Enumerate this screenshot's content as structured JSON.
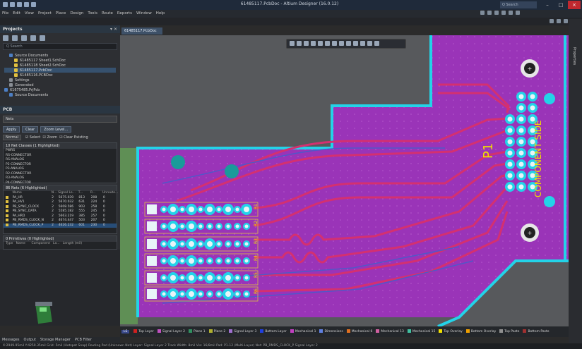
{
  "window": {
    "title": "61485117.PcbDoc - Altium Designer (16.0.12)",
    "search_placeholder": "Q Search",
    "min_icon": "minimize-icon",
    "max_icon": "maximize-icon",
    "close_symbol": "×"
  },
  "menu": [
    "File",
    "Edit",
    "View",
    "Project",
    "Place",
    "Design",
    "Tools",
    "Route",
    "Reports",
    "Window",
    "Help"
  ],
  "projects_panel": {
    "title": "Projects",
    "controls": "▾ ✕",
    "search_placeholder": "Q Search",
    "tree": [
      {
        "label": "Source Documents",
        "indent": 1,
        "color": "#4d7fc4"
      },
      {
        "label": "61485117 Sheet1.SchDoc",
        "indent": 2,
        "color": "#e0c040"
      },
      {
        "label": "61485118 Sheet2.SchDoc",
        "indent": 2,
        "color": "#e0c040"
      },
      {
        "label": "61485117.PcbDoc",
        "indent": 2,
        "color": "#e0c040",
        "selected": true
      },
      {
        "label": "61485116.PCBDoc",
        "indent": 2,
        "color": "#e0c040"
      },
      {
        "label": "Settings",
        "indent": 1,
        "color": "#8a8f96"
      },
      {
        "label": "Generated",
        "indent": 1,
        "color": "#8a8f96"
      },
      {
        "label": "61675485.PrjPcb",
        "indent": 0,
        "color": "#4d7fc4"
      },
      {
        "label": "Source Documents",
        "indent": 1,
        "color": "#4d7fc4"
      }
    ]
  },
  "pcb_panel": {
    "title": "PCB",
    "mode": "Nets",
    "buttons": [
      "Apply",
      "Clear",
      "Zoom Level..."
    ],
    "mask_label": "Normal",
    "options": [
      "Select",
      "Zoom",
      "Clear Existing"
    ],
    "net_classes_header": "10 Net Classes (1 Highlighted)",
    "net_classes": [
      "PWRS",
      "RS-CONNECTOR",
      "RS-ANALOG",
      "P2-CONNECTOR",
      "P3-ANALOG",
      "R2-CONNECTOR",
      "R3-ANALOG",
      "P4-CONNECTOR"
    ],
    "nets_header": "86 Nets (6 Highlighted)",
    "nets_columns": [
      "",
      "Name",
      "N...",
      "Signal Le...",
      "T...",
      "R...",
      "Unroute..."
    ],
    "nets": [
      {
        "name": "PA_HR",
        "n": "2",
        "len": "5675.039",
        "t": "813",
        "r": "208",
        "u": "0",
        "color": "#e0c040"
      },
      {
        "name": "PA_HV1",
        "n": "2",
        "len": "5670.032",
        "t": "631",
        "r": "224",
        "u": "0",
        "color": "#e0c040"
      },
      {
        "name": "PB_SYNC_CLOCK",
        "n": "2",
        "len": "5608.586",
        "t": "903",
        "r": "258",
        "u": "0",
        "color": "#e0c040"
      },
      {
        "name": "PB_SYNC_DATA",
        "n": "2",
        "len": "5585.182",
        "t": "555",
        "r": "245",
        "u": "0",
        "color": "#e0c040"
      },
      {
        "name": "PA_HRD",
        "n": "2",
        "len": "5663.219",
        "t": "385",
        "r": "257",
        "u": "0",
        "color": "#e0c040"
      },
      {
        "name": "PB_RMDS_CLOCK_N",
        "n": "2",
        "len": "4674.447",
        "t": "503",
        "r": "207",
        "u": "0",
        "color": "#e0c040"
      },
      {
        "name": "PB_RMDS_CLOCK_P",
        "n": "2",
        "len": "4626.232",
        "t": "601",
        "r": "230",
        "u": "0",
        "color": "#e0c040",
        "selected": true
      }
    ],
    "primitives_header": "0 Primitives (0 Highlighted)",
    "primitives_columns": [
      "Type",
      "Name",
      "Component",
      "La...",
      "Length (mil)"
    ]
  },
  "panel_tabs": [
    "Messages",
    "Output",
    "Storage Manager",
    "PCB Filter"
  ],
  "doc_tab": "61485117.PcbDoc",
  "right_strip_label": "Properties",
  "board": {
    "designator": "P1",
    "silk_text": "COMPONENT SIDE",
    "row_labels": [
      "R1",
      "R2",
      "R3",
      "R4",
      "R5",
      "R6"
    ]
  },
  "layer_bar": {
    "ls_label": "LS",
    "layers": [
      {
        "name": "Top Layer",
        "color": "#d02020"
      },
      {
        "name": "Signal Layer 2",
        "color": "#c050c0"
      },
      {
        "name": "Plane 1",
        "color": "#309060"
      },
      {
        "name": "Plane 2",
        "color": "#b0b030"
      },
      {
        "name": "Signal Layer 3",
        "color": "#a070d0"
      },
      {
        "name": "Bottom Layer",
        "color": "#2040e0"
      },
      {
        "name": "Mechanical 1",
        "color": "#c040c0"
      },
      {
        "name": "Dimensions",
        "color": "#6080e0"
      },
      {
        "name": "Mechanical 6",
        "color": "#e07020"
      },
      {
        "name": "Mechanical 13",
        "color": "#d060a0"
      },
      {
        "name": "Mechanical 15",
        "color": "#40c0a0"
      },
      {
        "name": "Top Overlay",
        "color": "#f0e000"
      },
      {
        "name": "Bottom Overlay",
        "color": "#f0a000"
      },
      {
        "name": "Top Paste",
        "color": "#909090"
      },
      {
        "name": "Bottom Paste",
        "color": "#a03030"
      }
    ]
  },
  "statusbar": "X:2949.95mil Y:4250.35mil Grid: 5mil (Hotspot Snap)   Routing Pad (Unknown Net)  Layer: Signal Layer 2   Track Width: 8mil   Via: 16/8mil   Pad: P1-12 (Multi-Layer)   Net: PB_RMDS_CLOCK_P   Signal Layer 2"
}
